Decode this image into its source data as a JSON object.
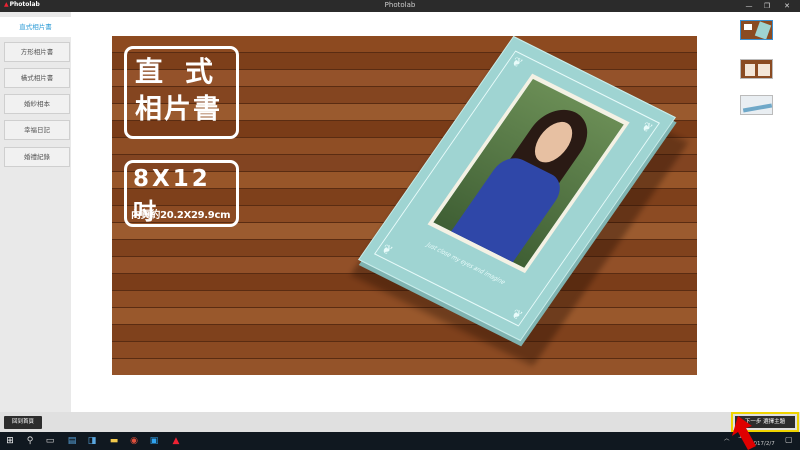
{
  "window": {
    "app_logo": "Photolab",
    "title": "Photolab",
    "controls": [
      "—",
      "❐",
      "✕"
    ]
  },
  "sidebar": {
    "items": [
      {
        "label": "直式相片書",
        "active": true
      },
      {
        "label": "方形相片書",
        "active": false
      },
      {
        "label": "橫式相片書",
        "active": false
      },
      {
        "label": "婚紗相本",
        "active": false
      },
      {
        "label": "幸福日記",
        "active": false
      },
      {
        "label": "婚禮紀錄",
        "active": false
      }
    ]
  },
  "preview": {
    "stamp_line1": "直式",
    "stamp_line2": "相片書",
    "size_big": "8X12吋",
    "size_small": "內頁約20.2X29.9cm",
    "book_caption": "Just close my eyes and imagine"
  },
  "thumbnails": [
    "thumbnail-1",
    "thumbnail-2",
    "thumbnail-3"
  ],
  "bottom": {
    "home_label": "回到首頁",
    "next_label": "下一步 選擇主題"
  },
  "taskbar": {
    "date": "2017/2/7",
    "time": "",
    "colors": {
      "accent": "#2a9ad6",
      "highlight": "#f0d400",
      "arrow": "#e00000"
    }
  }
}
